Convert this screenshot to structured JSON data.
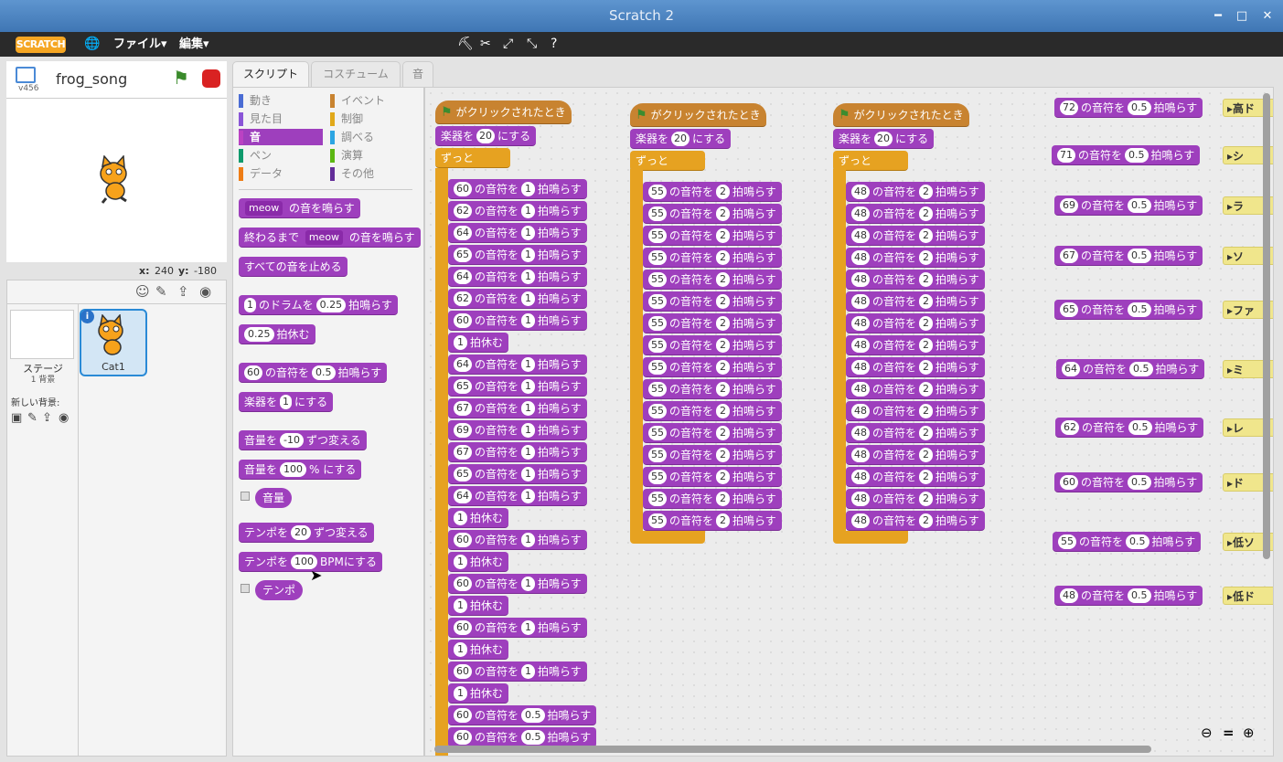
{
  "window": {
    "title": "Scratch 2"
  },
  "menu": {
    "logo": "SCRATCH",
    "file": "ファイル▾",
    "edit": "編集▾"
  },
  "stage": {
    "project_name": "frog_song",
    "version": "v456",
    "x_label": "x:",
    "x": "240",
    "y_label": "y:",
    "y": "-180"
  },
  "sprites": {
    "stage_label": "ステージ",
    "stage_backdrops": "1 背景",
    "new_backdrop": "新しい背景:",
    "sprite_name": "Cat1"
  },
  "tabs": [
    "スクリプト",
    "コスチューム",
    "音"
  ],
  "categories": [
    {
      "label": "動き",
      "color": "#4a6cd4"
    },
    {
      "label": "見た目",
      "color": "#8a55d7"
    },
    {
      "label": "音",
      "color": "#bb42c3"
    },
    {
      "label": "ペン",
      "color": "#0e9a6c"
    },
    {
      "label": "データ",
      "color": "#ee7d16"
    },
    {
      "label": "イベント",
      "color": "#c88330"
    },
    {
      "label": "制御",
      "color": "#e1a91a"
    },
    {
      "label": "調べる",
      "color": "#2ca5e2"
    },
    {
      "label": "演算",
      "color": "#5cb712"
    },
    {
      "label": "その他",
      "color": "#632d99"
    }
  ],
  "palette": {
    "play_sound_pre": "meow",
    "play_sound_post": "の音を鳴らす",
    "play_until_pre": "終わるまで",
    "play_until_arg": "meow",
    "play_until_post": "の音を鳴らす",
    "stop_all": "すべての音を止める",
    "drum_n": "1",
    "drum_mid": "のドラムを",
    "drum_beats": "0.25",
    "drum_post": "拍鳴らす",
    "rest_n": "0.25",
    "rest_post": "拍休む",
    "note_n": "60",
    "note_mid": "の音符を",
    "note_beats": "0.5",
    "note_post": "拍鳴らす",
    "instr_pre": "楽器を",
    "instr_n": "1",
    "instr_post": "にする",
    "vol_change_pre": "音量を",
    "vol_change_n": "-10",
    "vol_change_post": "ずつ変える",
    "vol_set_pre": "音量を",
    "vol_set_n": "100",
    "vol_set_post": "% にする",
    "volume": "音量",
    "tempo_change_pre": "テンポを",
    "tempo_change_n": "20",
    "tempo_change_post": "ずつ変える",
    "tempo_set_pre": "テンポを",
    "tempo_set_n": "100",
    "tempo_set_post": "BPMにする",
    "tempo": "テンポ"
  },
  "script_text": {
    "flag_clicked": "がクリックされたとき",
    "instrument_pre": "楽器を",
    "instrument_val": "20",
    "instrument_post": "にする",
    "forever": "ずっと",
    "note_mid": "の音符を",
    "note_post": "拍鳴らす",
    "rest_post": "拍休む"
  },
  "script1": [
    {
      "t": "n",
      "v": "60",
      "b": "1"
    },
    {
      "t": "n",
      "v": "62",
      "b": "1"
    },
    {
      "t": "n",
      "v": "64",
      "b": "1"
    },
    {
      "t": "n",
      "v": "65",
      "b": "1"
    },
    {
      "t": "n",
      "v": "64",
      "b": "1"
    },
    {
      "t": "n",
      "v": "62",
      "b": "1"
    },
    {
      "t": "n",
      "v": "60",
      "b": "1"
    },
    {
      "t": "r",
      "b": "1"
    },
    {
      "t": "n",
      "v": "64",
      "b": "1"
    },
    {
      "t": "n",
      "v": "65",
      "b": "1"
    },
    {
      "t": "n",
      "v": "67",
      "b": "1"
    },
    {
      "t": "n",
      "v": "69",
      "b": "1"
    },
    {
      "t": "n",
      "v": "67",
      "b": "1"
    },
    {
      "t": "n",
      "v": "65",
      "b": "1"
    },
    {
      "t": "n",
      "v": "64",
      "b": "1"
    },
    {
      "t": "r",
      "b": "1"
    },
    {
      "t": "n",
      "v": "60",
      "b": "1"
    },
    {
      "t": "r",
      "b": "1"
    },
    {
      "t": "n",
      "v": "60",
      "b": "1"
    },
    {
      "t": "r",
      "b": "1"
    },
    {
      "t": "n",
      "v": "60",
      "b": "1"
    },
    {
      "t": "r",
      "b": "1"
    },
    {
      "t": "n",
      "v": "60",
      "b": "1"
    },
    {
      "t": "r",
      "b": "1"
    },
    {
      "t": "n",
      "v": "60",
      "b": "0.5"
    },
    {
      "t": "n",
      "v": "60",
      "b": "0.5"
    }
  ],
  "script2": {
    "value": "55",
    "beats": "2",
    "count": 16
  },
  "script3": {
    "value": "48",
    "beats": "2",
    "count": 16
  },
  "defs": [
    {
      "v": "72",
      "b": "0.5",
      "call": "高ド"
    },
    {
      "v": "71",
      "b": "0.5",
      "call": "シ"
    },
    {
      "v": "69",
      "b": "0.5",
      "call": "ラ"
    },
    {
      "v": "67",
      "b": "0.5",
      "call": "ソ"
    },
    {
      "v": "65",
      "b": "0.5",
      "call": "ファ"
    },
    {
      "v": "64",
      "b": "0.5",
      "call": "ミ"
    },
    {
      "v": "62",
      "b": "0.5",
      "call": "レ"
    },
    {
      "v": "60",
      "b": "0.5",
      "call": "ド"
    },
    {
      "v": "55",
      "b": "0.5",
      "call": "低ソ"
    },
    {
      "v": "48",
      "b": "0.5",
      "call": "低ド"
    }
  ]
}
